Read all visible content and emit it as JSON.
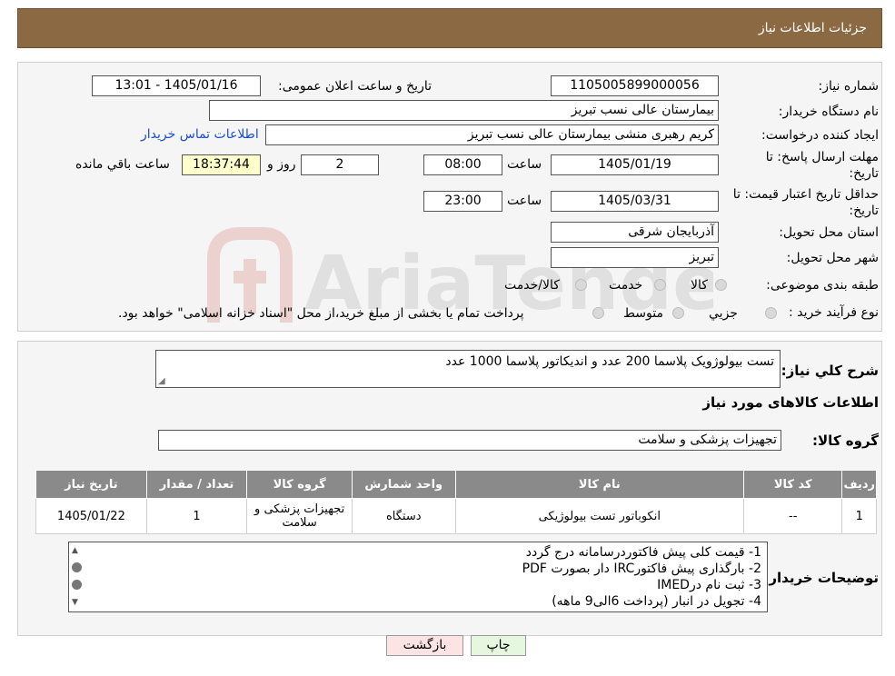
{
  "header": {
    "title": "جزئیات اطلاعات نیاز"
  },
  "form": {
    "need_number_label": "شماره نیاز:",
    "need_number": "1105005899000056",
    "announce_label": "تاریخ و ساعت اعلان عمومی:",
    "announce_value": "1405/01/16 - 13:01",
    "buyer_org_label": "نام دستگاه خریدار:",
    "buyer_org": "بیمارستان عالی نسب تبریز",
    "creator_label": "ایجاد کننده درخواست:",
    "creator": "کریم رهبری منشی بیمارستان عالی نسب تبریز",
    "contact_link": "اطلاعات تماس خریدار",
    "deadline_label_1": "مهلت ارسال پاسخ: تا",
    "deadline_label_2": "تاریخ:",
    "deadline_date": "1405/01/19",
    "time_label": "ساعت",
    "deadline_time": "08:00",
    "days_value": "2",
    "days_label": "روز و",
    "remaining_time": "18:37:44",
    "remaining_label": "ساعت باقي مانده",
    "validity_label_1": "حداقل تاریخ اعتبار قیمت: تا",
    "validity_label_2": "تاریخ:",
    "validity_date": "1405/03/31",
    "validity_time": "23:00",
    "province_label": "استان محل تحویل:",
    "province": "آذربایجان شرقی",
    "city_label": "شهر محل تحویل:",
    "city": "تبریز",
    "category_label": "طبقه بندی موضوعی:",
    "category_options": [
      "کالا",
      "خدمت",
      "کالا/خدمت"
    ],
    "process_label": "نوع فرآیند خرید :",
    "process_options": [
      "جزیي",
      "متوسط"
    ],
    "process_note": "پرداخت تمام یا بخشی از مبلغ خرید،از محل \"اسناد خزانه اسلامی\" خواهد بود."
  },
  "summary": {
    "label": "شرح کلي نياز:",
    "value": "تست بیولوژویک پلاسما 200 عدد و اندیکاتور پلاسما 1000 عدد"
  },
  "goods_section": {
    "title": "اطلاعات کالاهای مورد نیاز",
    "group_label": "گروه کالا:",
    "group_value": "تجهیزات پزشکی و سلامت"
  },
  "table": {
    "headers": [
      "ردیف",
      "کد کالا",
      "نام کالا",
      "واحد شمارش",
      "گروه کالا",
      "تعداد / مقدار",
      "تاریخ نیاز"
    ],
    "rows": [
      [
        "1",
        "--",
        "انکوباتور تست بیولوژیکی",
        "دستگاه",
        "تجهیزات پزشکی و سلامت",
        "1",
        "1405/01/22"
      ]
    ]
  },
  "buyer_notes": {
    "label": "توضیحات خریدار:",
    "lines": [
      "1- قیمت کلی پیش فاکتوردرسامانه درج گردد",
      "2- بارگذاری پیش فاکتورIRC دار بصورت PDF",
      "3- ثبت نام درIMED",
      "4- تجویل در انبار (پرداخت 6الی9 ماهه)"
    ]
  },
  "buttons": {
    "print": "چاپ",
    "back": "بازگشت"
  },
  "watermark": {
    "text": "AriaTender.neT"
  },
  "colors": {
    "header_bg": "#8b6a43",
    "table_header": "#8a8a8a",
    "print_btn": "#e6f7df",
    "back_btn": "#fde4e4"
  }
}
